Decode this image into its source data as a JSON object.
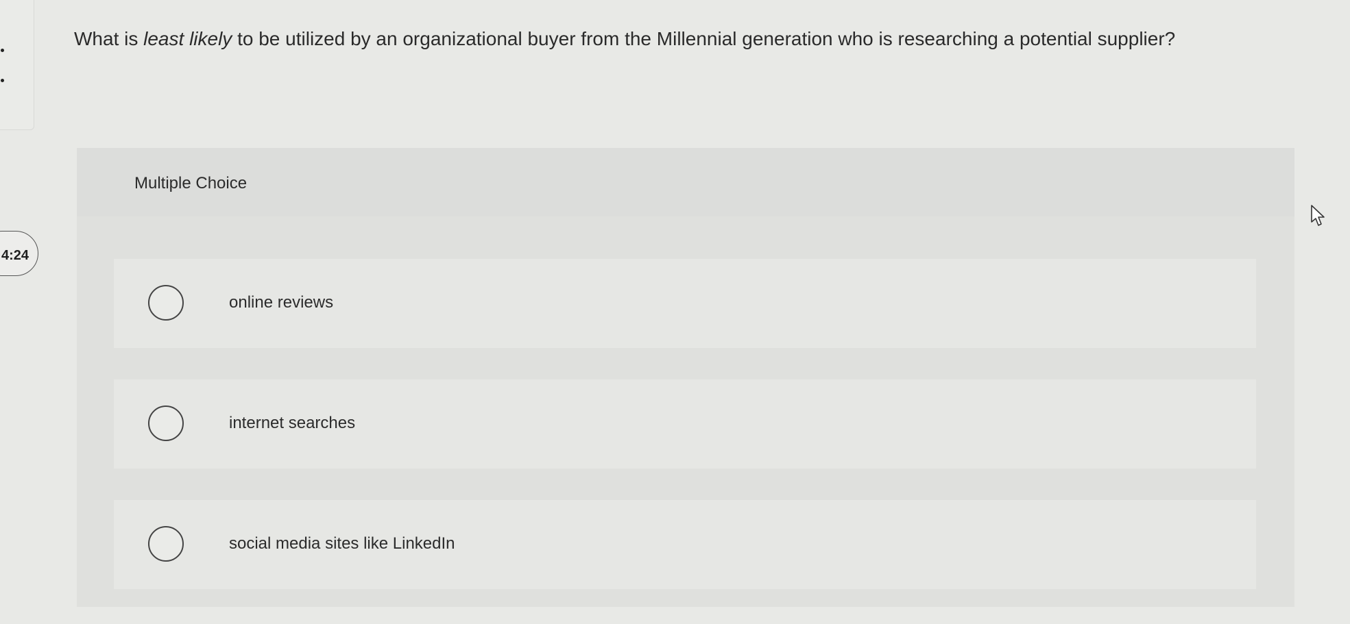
{
  "timer": {
    "text": "4:24"
  },
  "question": {
    "prefix": "What is ",
    "emphasis": "least likely",
    "suffix": " to be utilized by an organizational buyer from the Millennial generation who is researching a potential supplier?"
  },
  "choice_block": {
    "header": "Multiple Choice",
    "options": [
      {
        "label": "online reviews",
        "selected": false
      },
      {
        "label": "internet searches",
        "selected": false
      },
      {
        "label": "social media sites like LinkedIn",
        "selected": false
      }
    ]
  }
}
